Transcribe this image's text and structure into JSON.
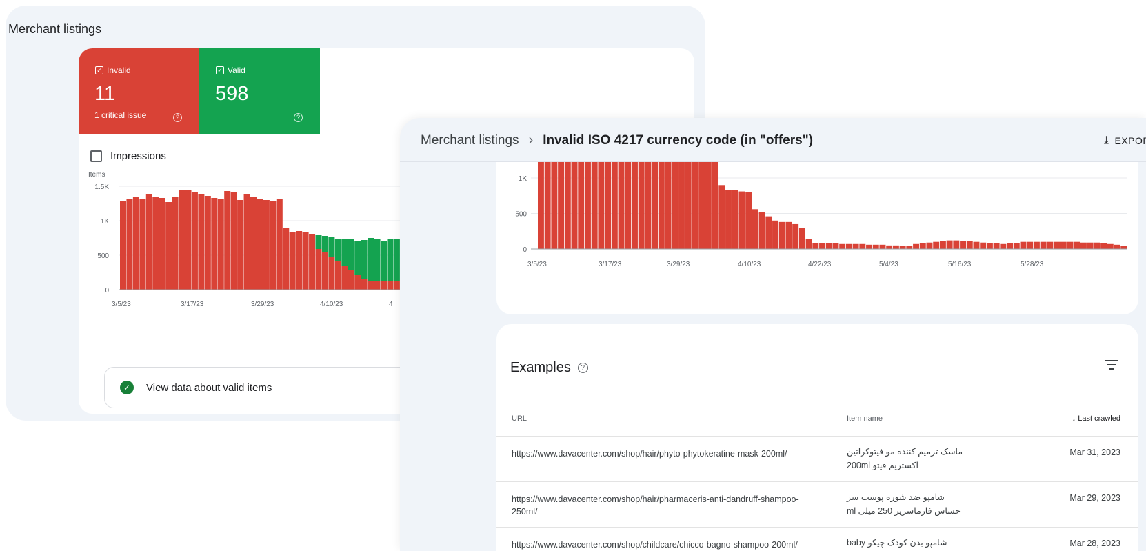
{
  "back_panel": {
    "title": "Merchant listings",
    "invalid": {
      "label": "Invalid",
      "value": "11",
      "sub": "1 critical issue",
      "color": "#d94236"
    },
    "valid": {
      "label": "Valid",
      "value": "598",
      "color": "#14a350"
    },
    "impressions_label": "Impressions",
    "valid_link_label": "View data about valid items",
    "chart_data": {
      "type": "bar",
      "stacked": true,
      "ylabel": "Items",
      "y_ticks": [
        "0",
        "500",
        "1K",
        "1.5K"
      ],
      "ylim": [
        0,
        1500
      ],
      "x_ticks": [
        "3/5/23",
        "3/17/23",
        "3/29/23",
        "4/10/23",
        "4"
      ],
      "grid": true,
      "series": [
        {
          "color": "#d94236",
          "values": [
            1290,
            1320,
            1340,
            1310,
            1380,
            1340,
            1330,
            1270,
            1350,
            1440,
            1440,
            1420,
            1380,
            1360,
            1330,
            1310,
            1430,
            1410,
            1300,
            1380,
            1340,
            1320,
            1300,
            1280,
            1310,
            900,
            840,
            850,
            830,
            800,
            590,
            540,
            480,
            410,
            340,
            280,
            210,
            160,
            130,
            130,
            120,
            120,
            120,
            110,
            110,
            110,
            110,
            110
          ]
        },
        {
          "color": "#14a350",
          "values": [
            0,
            0,
            0,
            0,
            0,
            0,
            0,
            0,
            0,
            0,
            0,
            0,
            0,
            0,
            0,
            0,
            0,
            0,
            0,
            0,
            0,
            0,
            0,
            0,
            0,
            0,
            0,
            0,
            0,
            0,
            200,
            240,
            290,
            330,
            390,
            450,
            490,
            560,
            620,
            600,
            590,
            620,
            610,
            570,
            560,
            560,
            620,
            610
          ]
        }
      ]
    }
  },
  "front_panel": {
    "breadcrumb_root": "Merchant listings",
    "breadcrumb_chevron": "›",
    "breadcrumb_current": "Invalid ISO 4217 currency code (in \"offers\")",
    "export_label": "EXPOR",
    "chart_data": {
      "type": "bar",
      "color": "#d94236",
      "y_ticks": [
        "0",
        "500",
        "1K"
      ],
      "ylim": [
        0,
        1600
      ],
      "x_ticks": [
        "3/5/23",
        "3/17/23",
        "3/29/23",
        "4/10/23",
        "4/22/23",
        "5/4/23",
        "5/16/23",
        "5/28/23"
      ],
      "grid": true,
      "values": [
        1500,
        1500,
        1500,
        1500,
        1500,
        1500,
        1500,
        1500,
        1500,
        1500,
        1480,
        1500,
        1500,
        1500,
        1500,
        1500,
        1500,
        1500,
        1420,
        1500,
        1500,
        1440,
        1500,
        1470,
        1450,
        1420,
        1400,
        900,
        830,
        830,
        810,
        800,
        560,
        520,
        460,
        400,
        380,
        380,
        350,
        300,
        140,
        80,
        80,
        80,
        80,
        70,
        70,
        70,
        70,
        60,
        60,
        60,
        50,
        50,
        40,
        40,
        70,
        80,
        90,
        100,
        110,
        120,
        120,
        110,
        110,
        100,
        90,
        80,
        80,
        70,
        80,
        80,
        100,
        100,
        100,
        100,
        100,
        100,
        100,
        100,
        100,
        90,
        90,
        90,
        80,
        70,
        60,
        40
      ]
    },
    "examples": {
      "title": "Examples",
      "columns": {
        "url": "URL",
        "name": "Item name",
        "crawled": "Last crawled",
        "sort_arrow": "↓"
      },
      "rows": [
        {
          "url": "https://www.davacenter.com/shop/hair/phyto-phytokeratine-mask-200ml/",
          "name": "ماسک ترمیم کننده مو فیتوکراتین اکستریم فیتو 200ml",
          "date": "Mar 31, 2023"
        },
        {
          "url": "https://www.davacenter.com/shop/hair/pharmaceris-anti-dandruff-shampoo-250ml/",
          "name": "شامپو ضد شوره پوست سر حساس فارماسریز 250 میلی ml",
          "date": "Mar 29, 2023"
        },
        {
          "url": "https://www.davacenter.com/shop/childcare/chicco-bagno-shampoo-200ml/",
          "name": "شامپو بدن کودک چیکو baby",
          "date": "Mar 28, 2023"
        }
      ]
    }
  }
}
